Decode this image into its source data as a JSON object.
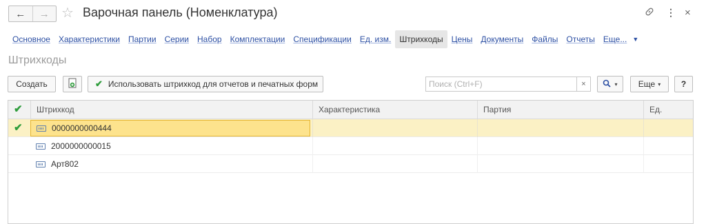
{
  "window": {
    "title": "Варочная панель (Номенклатура)",
    "back_icon": "←",
    "forward_icon": "→",
    "star_icon": "☆",
    "link_icon": "🔗",
    "menu_icon": "⋮",
    "close_icon": "×"
  },
  "tabs": [
    {
      "label": "Основное",
      "active": false
    },
    {
      "label": "Характеристики",
      "active": false
    },
    {
      "label": "Партии",
      "active": false
    },
    {
      "label": "Серии",
      "active": false
    },
    {
      "label": "Набор",
      "active": false
    },
    {
      "label": "Комплектации",
      "active": false
    },
    {
      "label": "Спецификации",
      "active": false
    },
    {
      "label": "Ед. изм.",
      "active": false
    },
    {
      "label": "Штрихкоды",
      "active": true
    },
    {
      "label": "Цены",
      "active": false
    },
    {
      "label": "Документы",
      "active": false
    },
    {
      "label": "Файлы",
      "active": false
    },
    {
      "label": "Отчеты",
      "active": false
    },
    {
      "label": "Еще...",
      "active": false
    }
  ],
  "section_title": "Штрихкоды",
  "toolbar": {
    "create_label": "Создать",
    "use_barcode_label": "Использовать штрихкод для отчетов и печатных форм",
    "search_placeholder": "Поиск (Ctrl+F)",
    "clear_icon": "×",
    "search_icon": "🔍",
    "more_label": "Еще",
    "help_label": "?"
  },
  "table": {
    "columns": [
      "Штрихкод",
      "Характеристика",
      "Партия",
      "Ед."
    ],
    "check_header": "✔",
    "rows": [
      {
        "selected": true,
        "checked": true,
        "barcode": "0000000000444",
        "characteristic": "",
        "batch": "",
        "unit": ""
      },
      {
        "selected": false,
        "checked": false,
        "barcode": "2000000000015",
        "characteristic": "",
        "batch": "",
        "unit": ""
      },
      {
        "selected": false,
        "checked": false,
        "barcode": "Арт802",
        "characteristic": "",
        "batch": "",
        "unit": ""
      }
    ]
  },
  "colors": {
    "link": "#2c4fa3",
    "check": "#2e9c3b",
    "selection": "#fbf1c5",
    "focus": "#fde38d"
  }
}
